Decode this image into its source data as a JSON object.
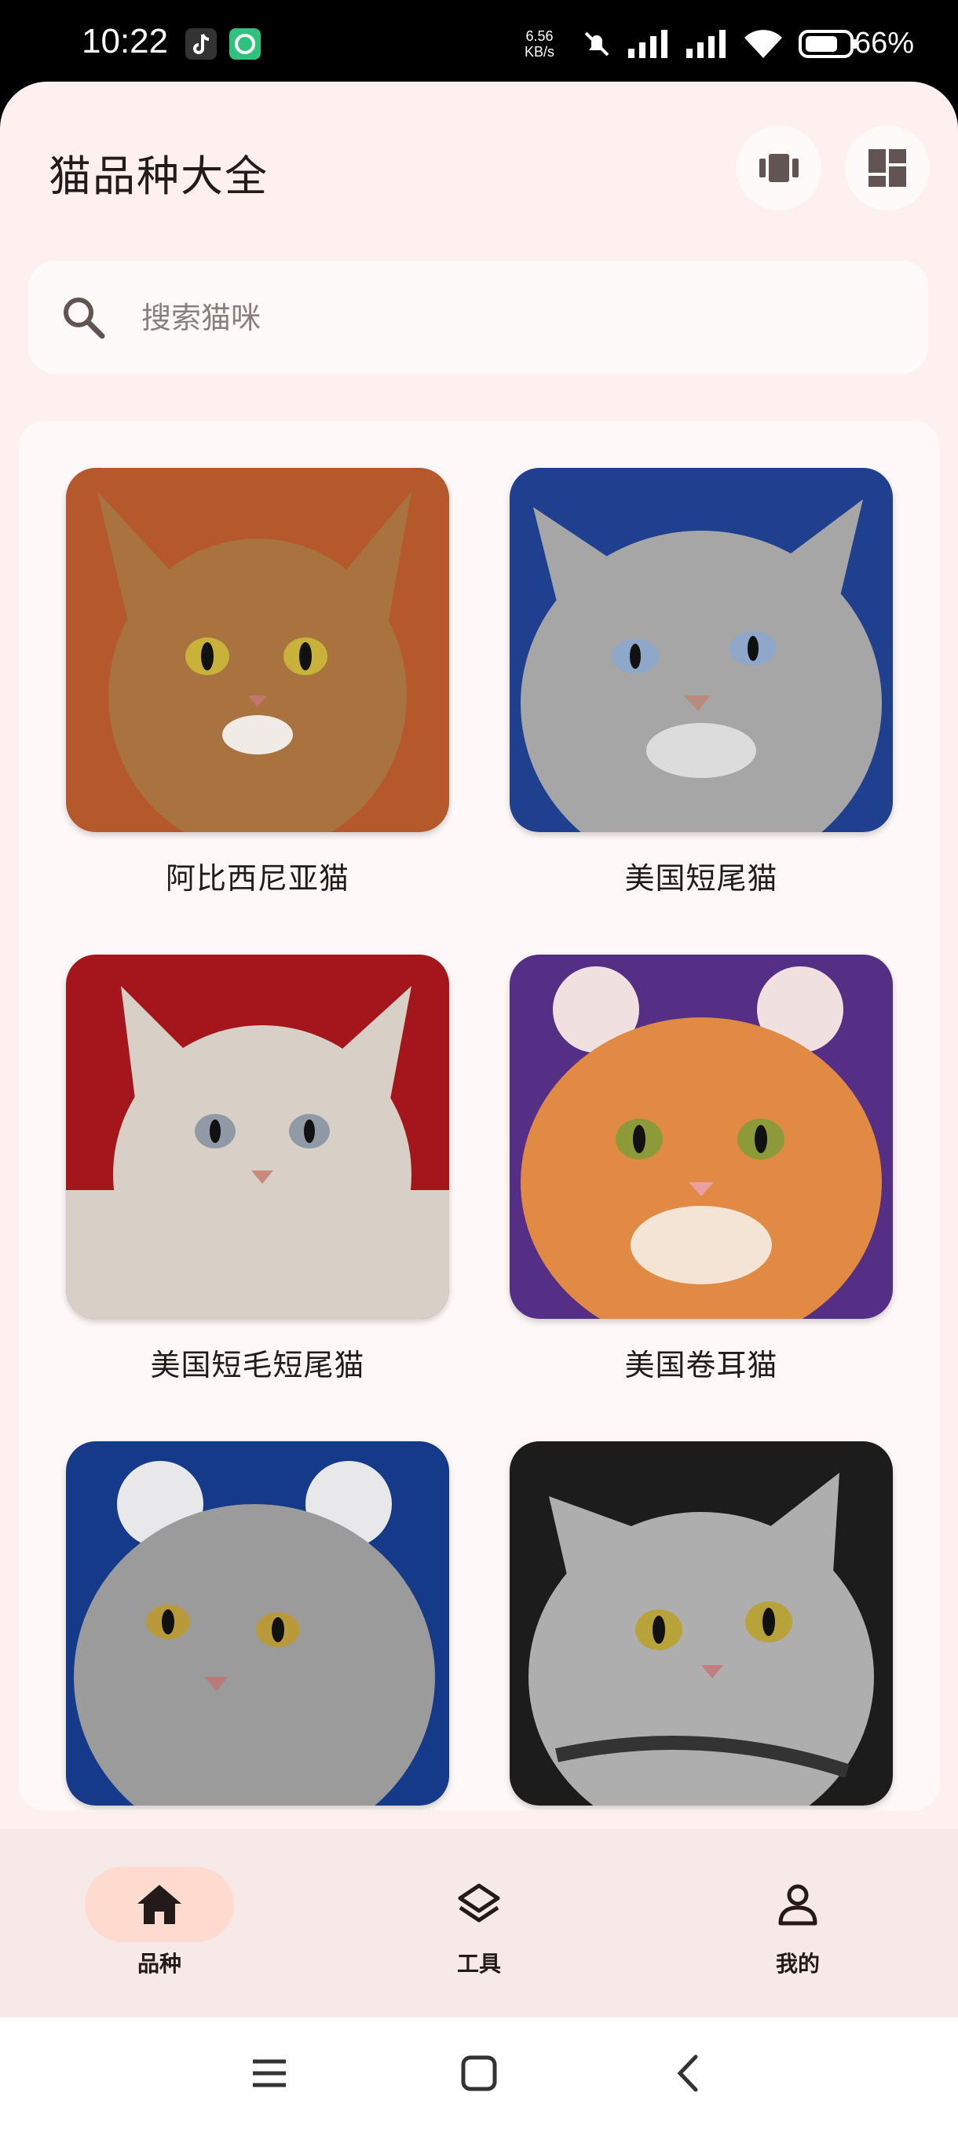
{
  "status_bar": {
    "time": "10:22",
    "net_speed_value": "6.56",
    "net_speed_unit": "KB/s",
    "battery": "66%"
  },
  "app": {
    "title": "猫品种大全",
    "search_placeholder": "搜索猫咪"
  },
  "cats": [
    {
      "name": "阿比西尼亚猫",
      "bg": "#b5582b",
      "fur": "#a8733f"
    },
    {
      "name": "美国短尾猫",
      "bg": "#1f3f8f",
      "fur": "#a6a6a6"
    },
    {
      "name": "美国短毛短尾猫",
      "bg": "#a4161c",
      "fur": "#d8cfc6"
    },
    {
      "name": "美国卷耳猫",
      "bg": "#552e86",
      "fur": "#e08a44"
    },
    {
      "name": "",
      "bg": "#163a8a",
      "fur": "#9b9b9b"
    },
    {
      "name": "",
      "bg": "#1c1c1c",
      "fur": "#aeaeae"
    }
  ],
  "bottom_nav": {
    "items": [
      {
        "label": "品种",
        "icon": "home-icon",
        "active": true
      },
      {
        "label": "工具",
        "icon": "layers-icon",
        "active": false
      },
      {
        "label": "我的",
        "icon": "person-icon",
        "active": false
      }
    ]
  },
  "colors": {
    "accent_pill": "#ffdbcf",
    "surface": "#fdf0ee",
    "text": "#231a1a"
  }
}
